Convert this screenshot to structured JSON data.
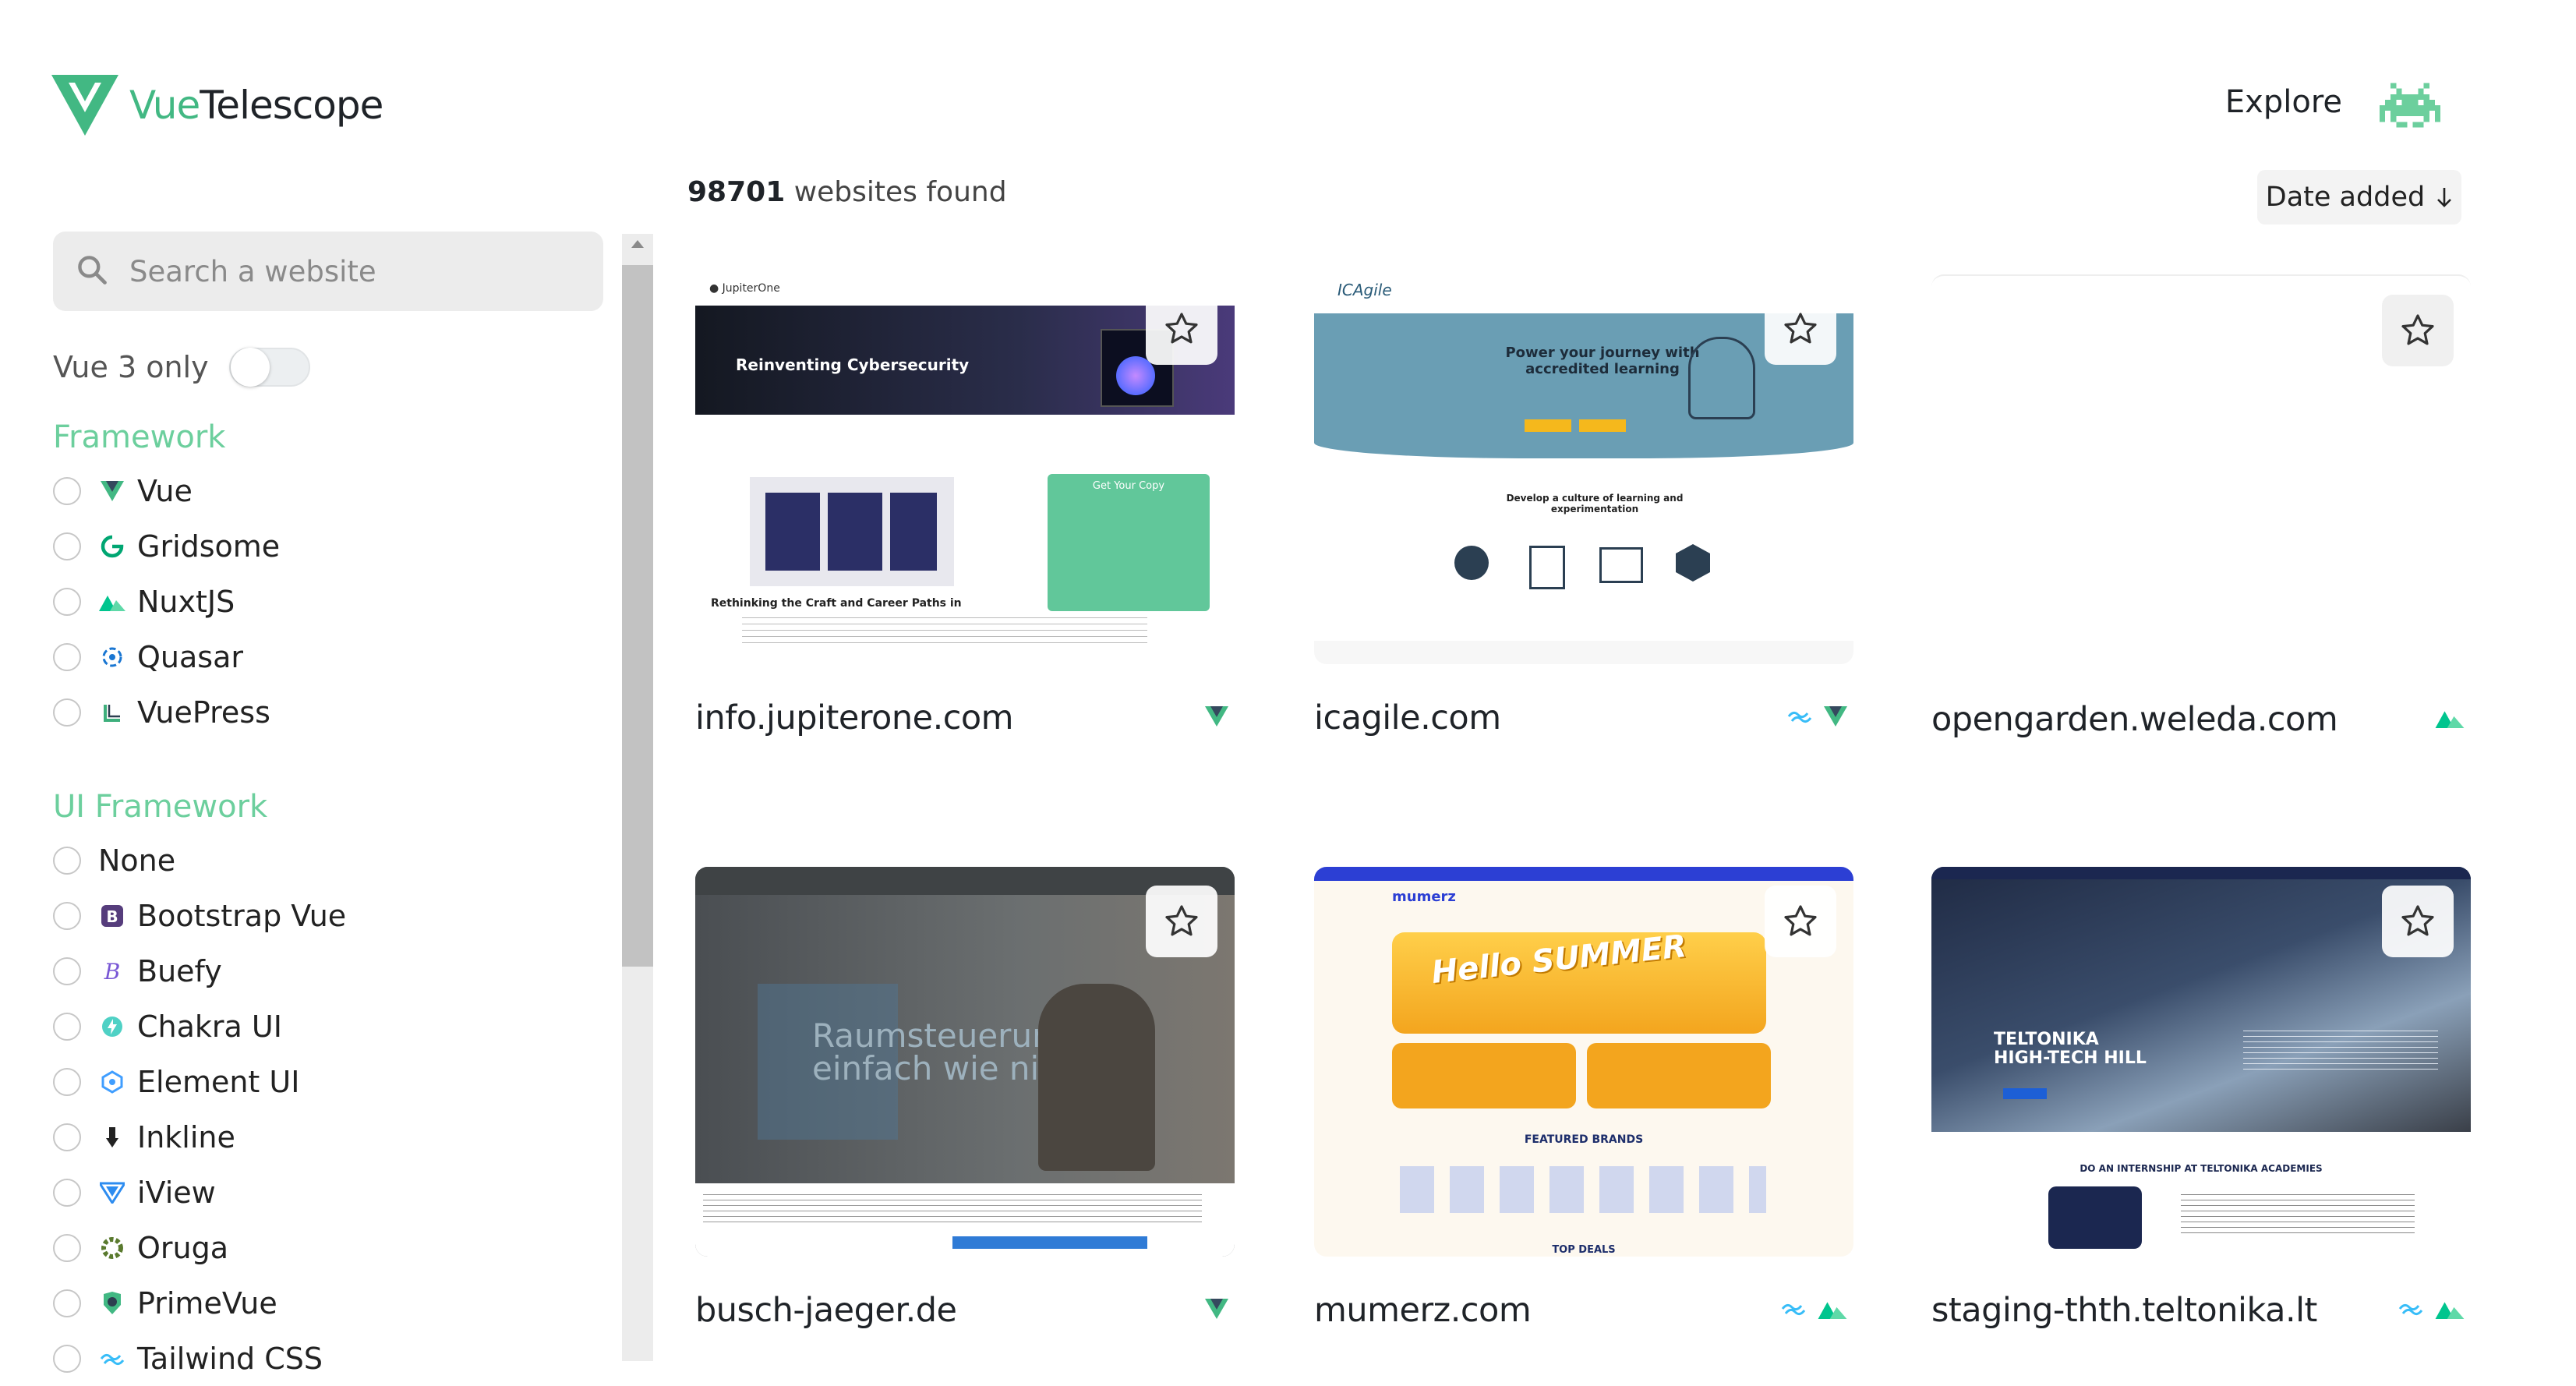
{
  "header": {
    "logo": {
      "part1": "Vue",
      "part2": "Telescope"
    },
    "nav": {
      "explore": "Explore"
    },
    "avatar_icon": "space-invader-icon",
    "accent_color": "#42b883"
  },
  "sidebar": {
    "search": {
      "placeholder": "Search a website",
      "value": ""
    },
    "vue3_toggle": {
      "label": "Vue 3 only",
      "on": false
    },
    "framework": {
      "title": "Framework",
      "items": [
        {
          "label": "Vue",
          "icon": "vue-icon"
        },
        {
          "label": "Gridsome",
          "icon": "gridsome-icon"
        },
        {
          "label": "NuxtJS",
          "icon": "nuxt-icon"
        },
        {
          "label": "Quasar",
          "icon": "quasar-icon"
        },
        {
          "label": "VuePress",
          "icon": "vuepress-icon"
        }
      ]
    },
    "ui_framework": {
      "title": "UI Framework",
      "items": [
        {
          "label": "None",
          "icon": ""
        },
        {
          "label": "Bootstrap Vue",
          "icon": "bootstrap-icon"
        },
        {
          "label": "Buefy",
          "icon": "buefy-icon"
        },
        {
          "label": "Chakra UI",
          "icon": "chakra-icon"
        },
        {
          "label": "Element UI",
          "icon": "element-icon"
        },
        {
          "label": "Inkline",
          "icon": "inkline-icon"
        },
        {
          "label": "iView",
          "icon": "iview-icon"
        },
        {
          "label": "Oruga",
          "icon": "oruga-icon"
        },
        {
          "label": "PrimeVue",
          "icon": "primevue-icon"
        },
        {
          "label": "Tailwind CSS",
          "icon": "tailwind-icon"
        }
      ]
    }
  },
  "main": {
    "count": "98701",
    "count_suffix": "websites found",
    "sort": {
      "label": "Date added",
      "icon": "arrow-down-icon"
    },
    "sites": [
      {
        "domain": "info.jupiterone.com",
        "techs": [
          "vue-icon"
        ],
        "thumb": {
          "headline": "Reinventing Cybersecurity",
          "sub": "Rethinking the Craft and Career Paths in",
          "form": "Get Your Copy"
        }
      },
      {
        "domain": "icagile.com",
        "techs": [
          "tailwind-icon",
          "vue-icon"
        ],
        "thumb": {
          "headline": "Power your journey with accredited learning",
          "sub": "Develop a culture of learning and experimentation"
        }
      },
      {
        "domain": "opengarden.weleda.com",
        "techs": [
          "nuxt-icon"
        ],
        "thumb": {}
      },
      {
        "domain": "busch-jaeger.de",
        "techs": [
          "vue-icon"
        ],
        "thumb": {
          "headline": "Raumsteuerung einfach wie nie"
        }
      },
      {
        "domain": "mumerz.com",
        "techs": [
          "tailwind-icon",
          "nuxt-icon"
        ],
        "thumb": {
          "headline": "Hello SUMMER",
          "sub": "FEATURED BRANDS",
          "foot": "TOP DEALS",
          "brand": "mumerz"
        }
      },
      {
        "domain": "staging-thth.teltonika.lt",
        "techs": [
          "tailwind-icon",
          "nuxt-icon"
        ],
        "thumb": {
          "headline": "TELTONIKA HIGH-TECH HILL",
          "sub": "DO AN INTERNSHIP AT TELTONIKA ACADEMIES"
        }
      }
    ]
  }
}
